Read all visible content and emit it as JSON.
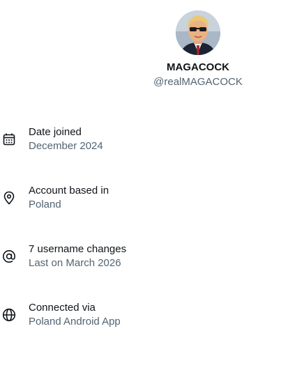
{
  "profile": {
    "display_name": "MAGACOCK",
    "handle": "@realMAGACOCK"
  },
  "about": [
    {
      "icon": "calendar-icon",
      "title": "Date joined",
      "value": "December 2024"
    },
    {
      "icon": "location-pin-icon",
      "title": "Account based in",
      "value": "Poland"
    },
    {
      "icon": "at-sign-icon",
      "title": "7 username changes",
      "value": "Last on March 2026"
    },
    {
      "icon": "globe-icon",
      "title": "Connected via",
      "value": "Poland Android App"
    }
  ],
  "colors": {
    "primary_text": "#0f1419",
    "secondary_text": "#536471"
  }
}
